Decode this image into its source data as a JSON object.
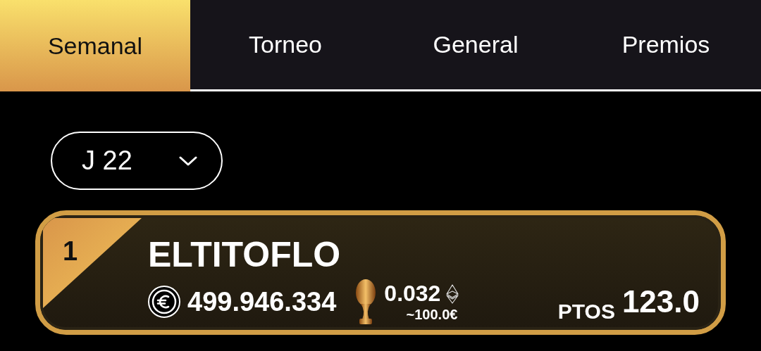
{
  "tabs": [
    {
      "label": "Semanal",
      "selected": true
    },
    {
      "label": "Torneo",
      "selected": false
    },
    {
      "label": "General",
      "selected": false
    },
    {
      "label": "Premios",
      "selected": false
    }
  ],
  "round_select": {
    "value": "J 22"
  },
  "entries": [
    {
      "rank": "1",
      "name": "ELTITOFLO",
      "coins": "499.946.334",
      "prize": "0.032",
      "prize_eur": "~100.0€",
      "points_label": "PTOS",
      "points": "123.0"
    }
  ]
}
